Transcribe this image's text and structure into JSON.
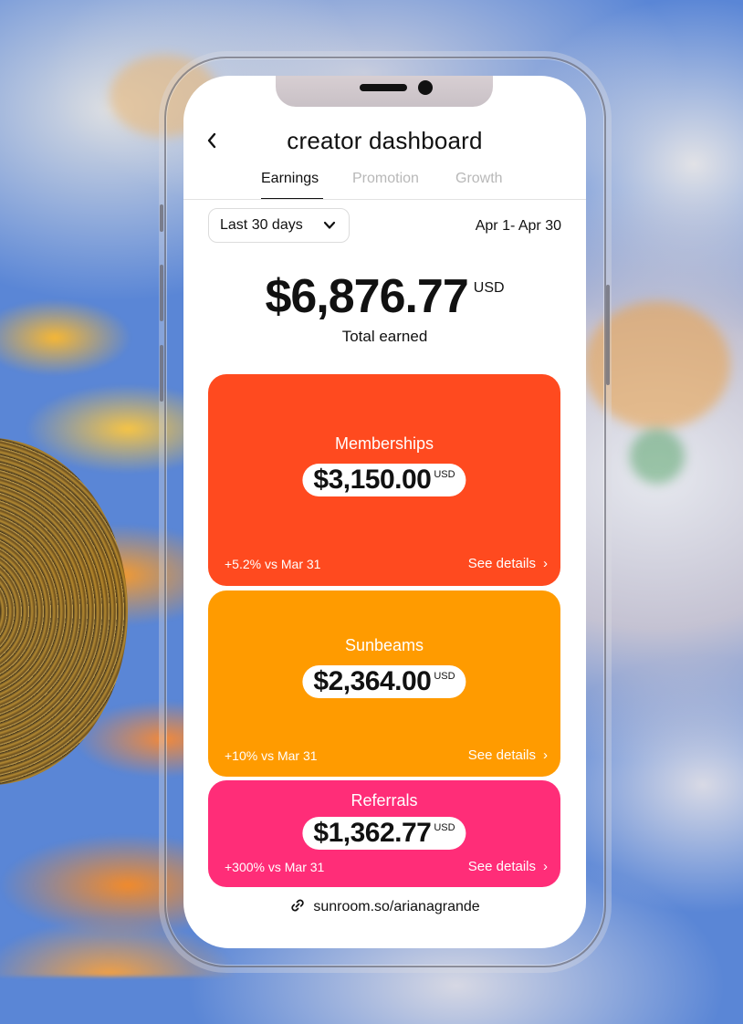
{
  "header": {
    "title": "creator dashboard",
    "back_icon": "chevron-left-icon"
  },
  "tabs": [
    {
      "label": "Earnings",
      "active": true
    },
    {
      "label": "Promotion",
      "active": false
    },
    {
      "label": "Growth",
      "active": false
    }
  ],
  "date_range": {
    "selected": "Last 30 days",
    "dates": "Apr 1- Apr 30"
  },
  "total": {
    "amount": "$6,876.77",
    "unit": "USD",
    "label": "Total earned"
  },
  "cards": [
    {
      "title": "Memberships",
      "amount": "$3,150.00",
      "unit": "USD",
      "change": "+5.2% vs  Mar 31",
      "link": "See details",
      "color": "#ff4a1f"
    },
    {
      "title": "Sunbeams",
      "amount": "$2,364.00",
      "unit": "USD",
      "change": "+10% vs Mar 31",
      "link": "See details",
      "color": "#ff9b00"
    },
    {
      "title": "Referrals",
      "amount": "$1,362.77",
      "unit": "USD",
      "change": "+300% vs Mar 31",
      "link": "See details",
      "color": "#ff2d78"
    }
  ],
  "footer": {
    "link": "sunroom.so/arianagrande",
    "icon": "link-icon"
  }
}
